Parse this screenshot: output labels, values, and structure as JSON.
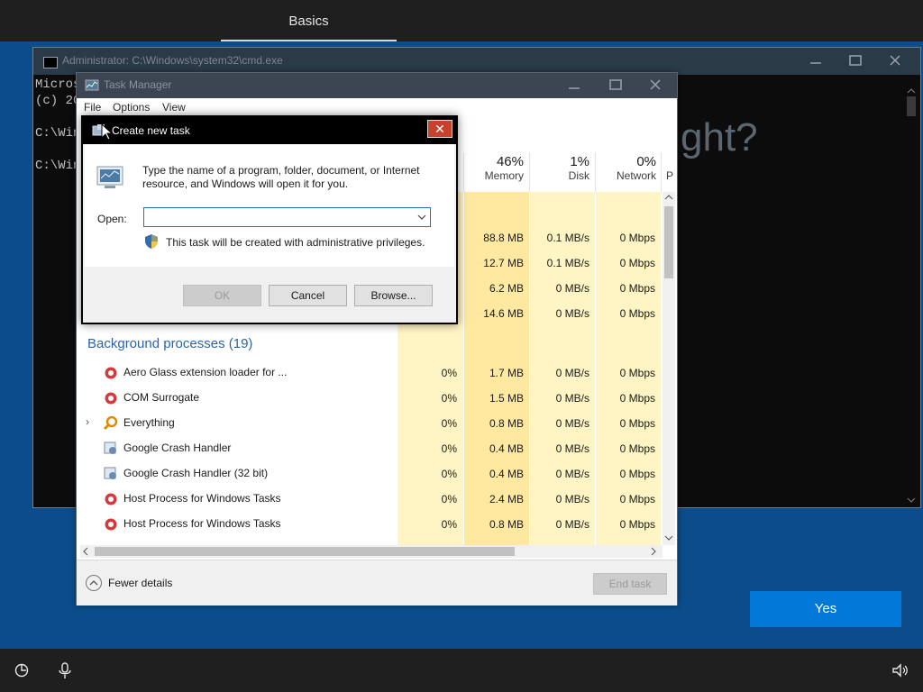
{
  "oobe": {
    "tab_label": "Basics",
    "background_text": "ght?",
    "yes_label": "Yes"
  },
  "cmd": {
    "title": "Administrator: C:\\Windows\\system32\\cmd.exe",
    "lines": [
      "Micros",
      "(c) 20",
      "",
      "C:\\Win",
      "",
      "C:\\Win"
    ]
  },
  "task_manager": {
    "title": "Task Manager",
    "menu": [
      "File",
      "Options",
      "View"
    ],
    "columns": [
      {
        "pct": "46%",
        "label": "Memory"
      },
      {
        "pct": "1%",
        "label": "Disk"
      },
      {
        "pct": "0%",
        "label": "Network"
      },
      {
        "pct": "",
        "label": "P"
      }
    ],
    "app_rows": [
      {
        "memory": "88.8 MB",
        "disk": "0.1 MB/s",
        "network": "0 Mbps"
      },
      {
        "memory": "12.7 MB",
        "disk": "0.1 MB/s",
        "network": "0 Mbps"
      },
      {
        "memory": "6.2 MB",
        "disk": "0 MB/s",
        "network": "0 Mbps"
      },
      {
        "memory": "14.6 MB",
        "disk": "0 MB/s",
        "network": "0 Mbps"
      }
    ],
    "group_label": "Background processes (19)",
    "processes": [
      {
        "name": "Aero Glass extension loader for ...",
        "cpu": "0%",
        "memory": "1.7 MB",
        "disk": "0 MB/s",
        "network": "0 Mbps"
      },
      {
        "name": "COM Surrogate",
        "cpu": "0%",
        "memory": "1.5 MB",
        "disk": "0 MB/s",
        "network": "0 Mbps"
      },
      {
        "name": "Everything",
        "cpu": "0%",
        "memory": "0.8 MB",
        "disk": "0 MB/s",
        "network": "0 Mbps"
      },
      {
        "name": "Google Crash Handler",
        "cpu": "0%",
        "memory": "0.4 MB",
        "disk": "0 MB/s",
        "network": "0 Mbps"
      },
      {
        "name": "Google Crash Handler (32 bit)",
        "cpu": "0%",
        "memory": "0.4 MB",
        "disk": "0 MB/s",
        "network": "0 Mbps"
      },
      {
        "name": "Host Process for Windows Tasks",
        "cpu": "0%",
        "memory": "2.4 MB",
        "disk": "0 MB/s",
        "network": "0 Mbps"
      },
      {
        "name": "Host Process for Windows Tasks",
        "cpu": "0%",
        "memory": "0.8 MB",
        "disk": "0 MB/s",
        "network": "0 Mbps"
      }
    ],
    "fewer_details": "Fewer details",
    "end_task": "End task"
  },
  "dialog": {
    "title": "Create new task",
    "message": "Type the name of a program, folder, document, or Internet resource, and Windows will open it for you.",
    "open_label": "Open:",
    "open_value": "",
    "admin_note": "This task will be created with administrative privileges.",
    "ok": "OK",
    "cancel": "Cancel",
    "browse": "Browse..."
  },
  "colors": {
    "accent": "#0078d7",
    "heat_light": "#fff4c4",
    "heat_medium": "#ffe8a0",
    "group_label": "#2a64ad",
    "close_red": "#c7412c"
  }
}
